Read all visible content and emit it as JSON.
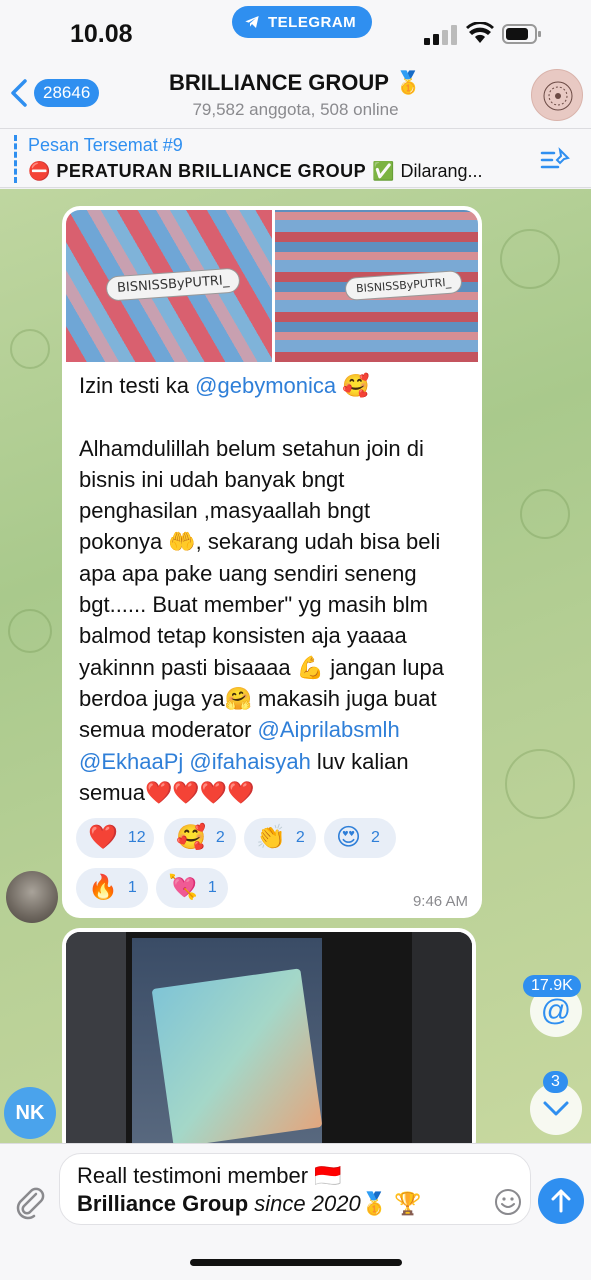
{
  "status_bar": {
    "time": "10.08",
    "app_pill": "TELEGRAM"
  },
  "header": {
    "back_count": "28646",
    "title": "BRILLIANCE GROUP 🥇",
    "subtitle": "79,582 anggota, 508 online"
  },
  "pinned": {
    "title": "Pesan Tersemat #9",
    "lead_emoji": "⛔",
    "text_bold": "PERATURAN BRILLIANCE GROUP",
    "check_emoji": "✅",
    "text_rest": "Dilarang..."
  },
  "message": {
    "photo_labels": [
      "BISNISSByPUTRI_",
      "BISNISSByPUTRI_"
    ],
    "line1_prefix": "Izin testi ka ",
    "line1_mention": "@gebymonica",
    "line1_emoji": " 🥰",
    "body": "Alhamdulillah belum setahun join di\nbisnis ini udah banyak bngt\npenghasilan ,masyaallah bngt\npokonya 🤲, sekarang udah bisa beli\napa apa pake uang sendiri seneng\nbgt...... Buat member\" yg masih blm\nbalmod tetap konsisten aja yaaaa\nyakinnn pasti bisaaaa 💪 jangan lupa\nberdoa juga ya🤗 makasih juga buat\nsemua moderator ",
    "mention_2": "@Aiprilabsmlh",
    "mention_3": "@EkhaaPj",
    "mention_4": "@ifahaisyah",
    "tail": " luv kalian\nsemua❤️❤️❤️❤️",
    "time": "9:46 AM",
    "reactions": [
      {
        "emoji": "❤️",
        "count": "12"
      },
      {
        "emoji": "🥰",
        "count": "2"
      },
      {
        "emoji": "👏",
        "count": "2"
      },
      {
        "emoji": "😍",
        "count": "2"
      },
      {
        "emoji": "🔥",
        "count": "1"
      },
      {
        "emoji": "💘",
        "count": "1"
      }
    ]
  },
  "floating": {
    "mention_count": "17.9K",
    "mention_symbol": "@",
    "unread_count": "3",
    "nk_initials": "NK"
  },
  "composer": {
    "line1": "Reall testimoni member 🇮🇩",
    "line2_bold": "Brilliance Group",
    "line2_italic": " since 2020",
    "line2_emoji": "🥇 🏆"
  },
  "colors": {
    "accent": "#2f8ff0",
    "mention": "#2f7fd8",
    "chat_bg": "#b6cf95"
  }
}
